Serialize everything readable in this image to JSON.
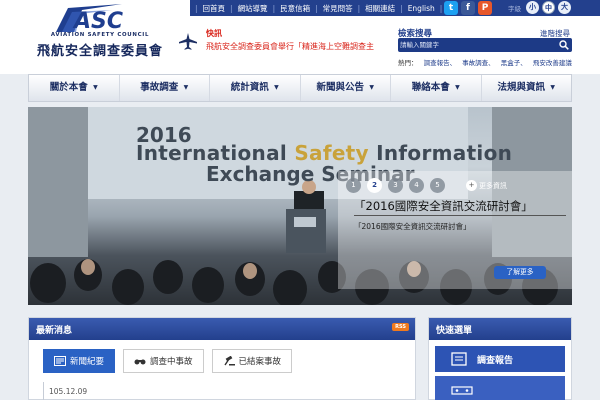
{
  "header": {
    "logo_text": "ASC",
    "logo_en": "AVIATION SAFETY COUNCIL",
    "logo_zh": "飛航安全調查委員會",
    "top_links": [
      "回首頁",
      "網站導覽",
      "民意信箱",
      "常見問答",
      "相關連結",
      "English"
    ],
    "social": [
      {
        "name": "twitter",
        "glyph": "t",
        "color": "#1da1f2"
      },
      {
        "name": "facebook",
        "glyph": "f",
        "color": "#3b5998"
      },
      {
        "name": "plurk",
        "glyph": "P",
        "color": "#e7572a"
      }
    ],
    "font_size_label": "字級",
    "font_sizes": [
      "小",
      "中",
      "大"
    ],
    "font_size_active": "中"
  },
  "flash": {
    "title": "快訊",
    "text": "飛航安全調查委員會舉行「精進海上空難調查主"
  },
  "search": {
    "title": "檢索搜尋",
    "advanced": "進階搜尋",
    "placeholder": "請輸入關鍵字",
    "hot_label": "熱門：",
    "hot_terms": [
      "調查報告、",
      "事故調查、",
      "黑盒子、",
      "飛安改善建議"
    ]
  },
  "nav": {
    "items": [
      "關於本會",
      "事故調查",
      "統計資訊",
      "新聞與公告",
      "聯絡本會",
      "法規與資訊"
    ]
  },
  "banner": {
    "line1": "2016",
    "line2a": "International ",
    "line2b": "Safety",
    "line2c": " Information",
    "line3": "Exchange Seminar",
    "dots": [
      "1",
      "2",
      "3",
      "4",
      "5"
    ],
    "active_dot": "2",
    "more": "更多資訊",
    "caption_title": "「2016國際安全資訊交流研討會」",
    "caption_sub": "「2016國際安全資訊交流研討會」",
    "know_more": "了解更多"
  },
  "news": {
    "title": "最新消息",
    "rss": "RSS",
    "tabs": [
      "新聞紀要",
      "調查中事故",
      "已結案事故"
    ],
    "active_tab": "新聞紀要",
    "first_date": "105.12.09"
  },
  "quick": {
    "title": "快速選單",
    "items": [
      "調查報告"
    ]
  }
}
